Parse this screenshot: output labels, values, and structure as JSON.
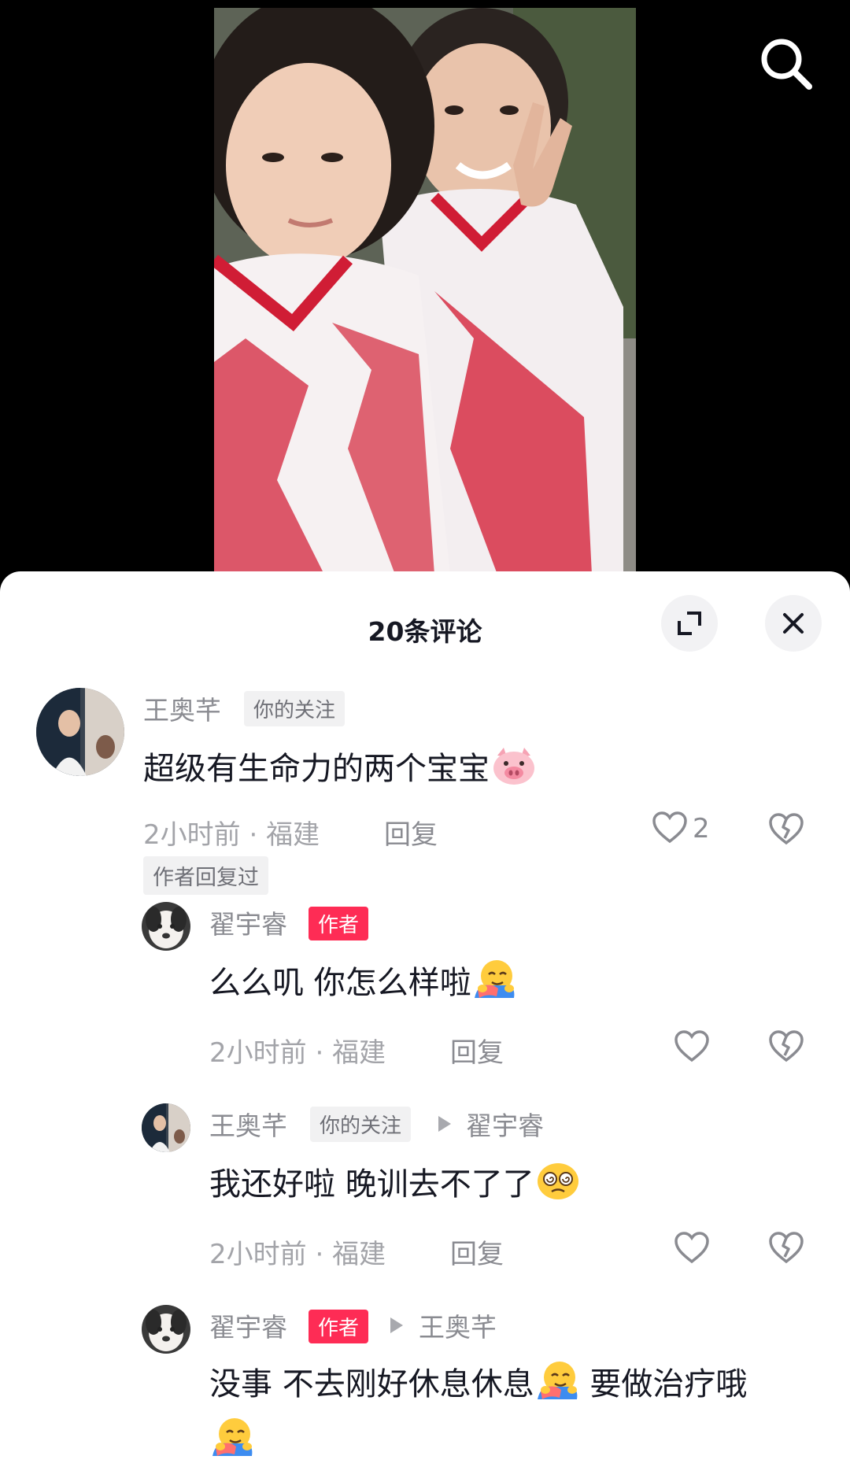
{
  "video": {
    "search_icon": "search-icon"
  },
  "sheet": {
    "title": "20条评论",
    "expand_icon": "expand-icon",
    "close_icon": "close-icon"
  },
  "comments": [
    {
      "user": "王奥芊",
      "follow_badge": "你的关注",
      "text": "超级有生命力的两个宝宝",
      "emoji": "pig-face-emoji",
      "time": "2小时前",
      "location": "福建",
      "reply_label": "回复",
      "likes": "2",
      "author_replied_tag": "作者回复过"
    }
  ],
  "replies": [
    {
      "user": "翟宇睿",
      "author_badge": "作者",
      "text": "么么叽 你怎么样啦",
      "emoji": "hugging-face-emoji",
      "time": "2小时前",
      "location": "福建",
      "reply_label": "回复"
    },
    {
      "user": "王奥芊",
      "follow_badge": "你的关注",
      "reply_to": "翟宇睿",
      "text": "我还好啦 晚训去不了了",
      "emoji": "dizzy-face-emoji",
      "time": "2小时前",
      "location": "福建",
      "reply_label": "回复"
    },
    {
      "user": "翟宇睿",
      "author_badge": "作者",
      "reply_to": "王奥芊",
      "text_part1": "没事 不去刚好休息休息",
      "text_part2": " 要做治疗哦",
      "emoji": "hugging-face-emoji"
    }
  ],
  "separator_dot": "·"
}
